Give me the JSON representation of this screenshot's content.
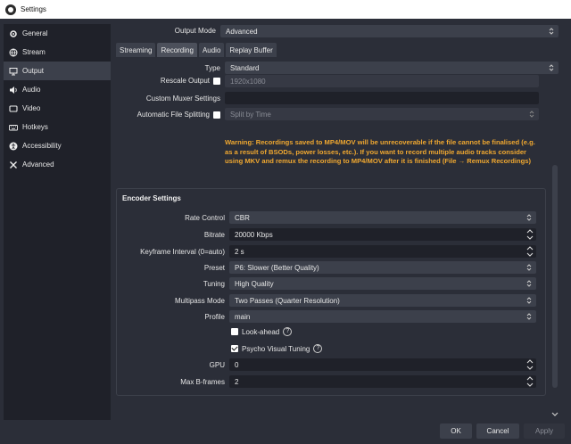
{
  "window": {
    "title": "Settings"
  },
  "sidebar": {
    "items": [
      {
        "label": "General",
        "icon": "gear-icon"
      },
      {
        "label": "Stream",
        "icon": "globe-icon"
      },
      {
        "label": "Output",
        "icon": "monitor-icon"
      },
      {
        "label": "Audio",
        "icon": "speaker-icon"
      },
      {
        "label": "Video",
        "icon": "screen-icon"
      },
      {
        "label": "Hotkeys",
        "icon": "keyboard-icon"
      },
      {
        "label": "Accessibility",
        "icon": "accessibility-icon"
      },
      {
        "label": "Advanced",
        "icon": "tools-icon"
      }
    ],
    "active_index": 2
  },
  "output_mode": {
    "label": "Output Mode",
    "value": "Advanced"
  },
  "tabs": [
    "Streaming",
    "Recording",
    "Audio",
    "Replay Buffer"
  ],
  "active_tab": "Recording",
  "recording": {
    "type": {
      "label": "Type",
      "value": "Standard"
    },
    "rescale_output": {
      "label": "Rescale Output",
      "value": "1920x1080",
      "checked": false
    },
    "custom_muxer": {
      "label": "Custom Muxer Settings",
      "value": ""
    },
    "auto_split": {
      "label": "Automatic File Splitting",
      "value": "Split by Time",
      "checked": false
    },
    "warning": "Warning: Recordings saved to MP4/MOV will be unrecoverable if the file cannot be finalised (e.g. as a result of BSODs, power losses, etc.). If you want to record multiple audio tracks consider using MKV and remux the recording to MP4/MOV after it is finished (File → Remux Recordings)"
  },
  "encoder": {
    "title": "Encoder Settings",
    "rate_control": {
      "label": "Rate Control",
      "value": "CBR"
    },
    "bitrate": {
      "label": "Bitrate",
      "value": "20000 Kbps"
    },
    "keyframe": {
      "label": "Keyframe Interval (0=auto)",
      "value": "2 s"
    },
    "preset": {
      "label": "Preset",
      "value": "P6: Slower (Better Quality)"
    },
    "tuning": {
      "label": "Tuning",
      "value": "High Quality"
    },
    "multipass": {
      "label": "Multipass Mode",
      "value": "Two Passes (Quarter Resolution)"
    },
    "profile": {
      "label": "Profile",
      "value": "main"
    },
    "look_ahead": {
      "label": "Look-ahead",
      "checked": false
    },
    "psycho_visual": {
      "label": "Psycho Visual Tuning",
      "checked": true
    },
    "gpu": {
      "label": "GPU",
      "value": "0"
    },
    "max_bframes": {
      "label": "Max B-frames",
      "value": "2"
    }
  },
  "buttons": {
    "ok": "OK",
    "cancel": "Cancel",
    "apply": "Apply"
  },
  "colors": {
    "warning": "#f0a830",
    "background": "#2b2e38",
    "sidebar": "#1f2129"
  }
}
